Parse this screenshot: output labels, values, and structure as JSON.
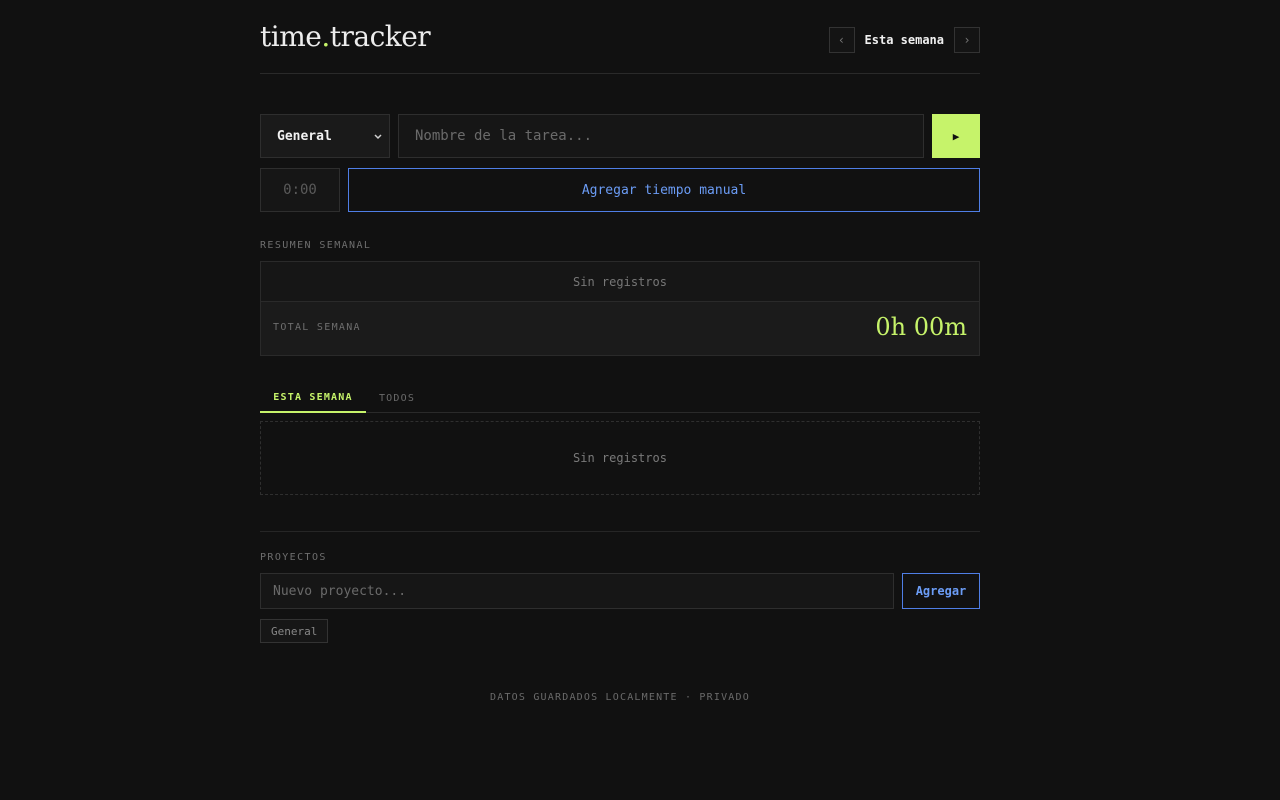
{
  "app": {
    "logo_left": "time",
    "logo_dot": ".",
    "logo_right": "tracker"
  },
  "week_nav": {
    "prev": "‹",
    "label": "Esta semana",
    "next": "›"
  },
  "entry": {
    "project_selected": "General",
    "task_placeholder": "Nombre de la tarea...",
    "start_button": "▶",
    "duration_placeholder": "0:00",
    "manual_button": "Agregar tiempo manual"
  },
  "summary": {
    "section_label": "RESUMEN SEMANAL",
    "empty_text": "Sin registros",
    "total_label": "TOTAL SEMANA",
    "total_value": "0h 00m"
  },
  "tabs": {
    "items": [
      {
        "label": "ESTA SEMANA",
        "active": true
      },
      {
        "label": "TODOS",
        "active": false
      }
    ],
    "empty_text": "Sin registros"
  },
  "projects": {
    "section_label": "PROYECTOS",
    "input_placeholder": "Nuevo proyecto...",
    "add_button": "Agregar",
    "tags": [
      "General"
    ]
  },
  "footer": {
    "text": "DATOS GUARDADOS LOCALMENTE · PRIVADO"
  },
  "colors": {
    "background": "#111111",
    "accent": "#c6f36a",
    "link_blue": "#6b9cf5"
  }
}
